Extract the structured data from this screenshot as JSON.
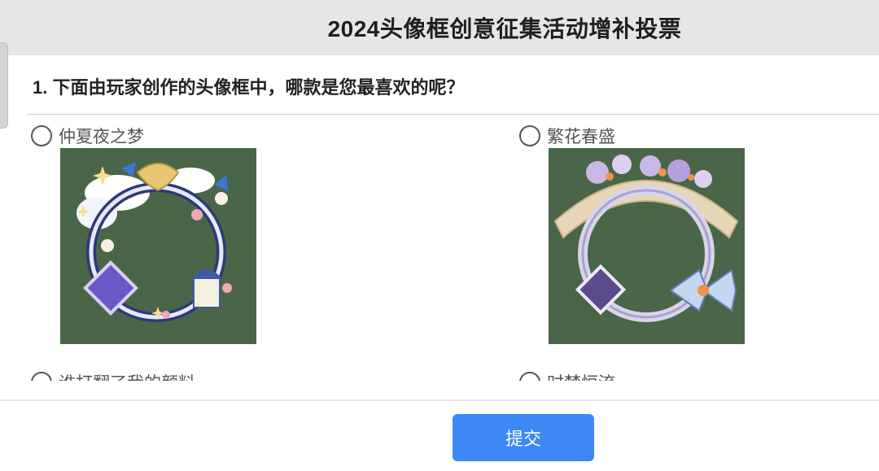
{
  "header": {
    "title": "2024头像框创意征集活动增补投票"
  },
  "question": {
    "text": "1. 下面由玩家创作的头像框中，哪款是您最喜欢的呢？"
  },
  "options": [
    {
      "label": "仲夏夜之梦",
      "image_icon": "avatar-frame-midsummer-night-dream"
    },
    {
      "label": "繁花春盛",
      "image_icon": "avatar-frame-spring-blossoms"
    },
    {
      "label": "谁打翻了我的颜料"
    },
    {
      "label": "时梦恒流"
    }
  ],
  "footer": {
    "submit_label": "提交"
  },
  "colors": {
    "header_bg": "#e6e6e6",
    "image_bg": "#4a6648",
    "submit_bg": "#3d88f5"
  }
}
